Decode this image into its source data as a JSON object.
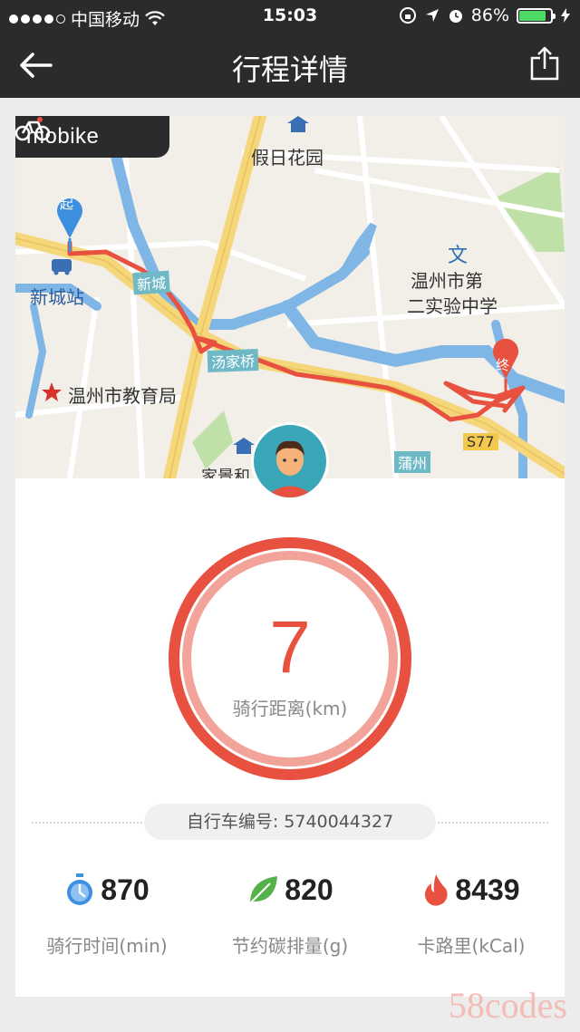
{
  "status_bar": {
    "carrier": "中国移动",
    "time": "15:03",
    "battery": "86%",
    "battery_level": 0.86
  },
  "nav": {
    "title": "行程详情",
    "back_icon": "arrow-left-icon",
    "share_icon": "share-icon"
  },
  "map": {
    "brand": "mobike",
    "labels": {
      "jiari": "假日花园",
      "xinchengzhan": "新城站",
      "school": "温州市第\n二实验中学",
      "school_line1": "温州市第",
      "school_line2": "二实验中学",
      "edu_bureau": "温州市教育局",
      "wen": "文",
      "xincheng_road": "新城",
      "tangjiaqiao": "汤家桥",
      "puzhou": "蒲州",
      "s77": "S77",
      "jiashi": "家景和"
    },
    "start_marker": "起",
    "end_marker": "终",
    "colors": {
      "route": "#e8503f",
      "water": "#7fb6e6",
      "road": "#f5d67a",
      "park": "#bfe0a6"
    }
  },
  "trip": {
    "distance": "7",
    "distance_label": "骑行距离(km)",
    "distance_ring_color": "#e8503f",
    "bike_number": "自行车编号: 5740044327"
  },
  "stats": [
    {
      "icon": "stopwatch-icon",
      "value": "870",
      "label": "骑行时间(min)",
      "color": "#3d8fe0"
    },
    {
      "icon": "leaf-icon",
      "value": "820",
      "label": "节约碳排量(g)",
      "color": "#56b14a"
    },
    {
      "icon": "flame-icon",
      "value": "8439",
      "label": "卡路里(kCal)",
      "color": "#e8503f"
    }
  ],
  "watermark": "58codes"
}
